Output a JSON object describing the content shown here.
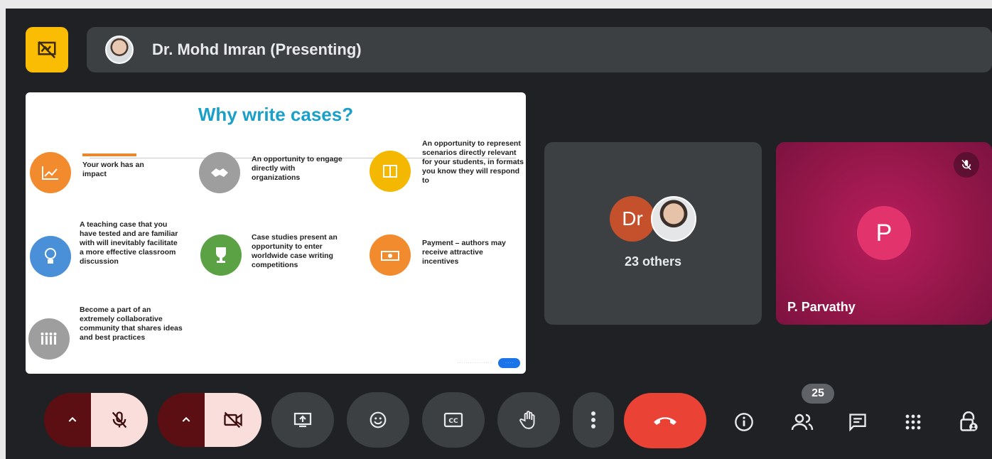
{
  "presenter": {
    "name": "Dr. Mohd Imran (Presenting)"
  },
  "slide": {
    "title": "Why write cases?",
    "items": [
      {
        "text": "Your work has an impact",
        "icon": "chart-icon",
        "color": "#f28b2e"
      },
      {
        "text": "An opportunity to engage directly with organizations",
        "icon": "handshake-icon",
        "color": "#9e9e9e"
      },
      {
        "text": "An opportunity to represent scenarios directly relevant for your students, in formats you know they will respond to",
        "icon": "book-icon",
        "color": "#f5b800"
      },
      {
        "text": "A teaching case that you have tested and are familiar with will inevitably facilitate a more effective classroom discussion",
        "icon": "lightbulb-icon",
        "color": "#4a90d9"
      },
      {
        "text": "Case studies present an opportunity to enter worldwide case writing competitions",
        "icon": "trophy-icon",
        "color": "#5ba245"
      },
      {
        "text": "Payment – authors may receive attractive incentives",
        "icon": "money-icon",
        "color": "#f28b2e"
      },
      {
        "text": "Become a part of an extremely collaborative community that shares ideas and best practices",
        "icon": "community-icon",
        "color": "#9e9e9e"
      }
    ]
  },
  "tiles": {
    "others": {
      "avatar_initials": "Dr",
      "label": "23 others"
    },
    "parvathy": {
      "avatar_initial": "P",
      "name": "P. Parvathy"
    }
  },
  "controls": {
    "participants_count": "25"
  },
  "colors": {
    "background": "#202124",
    "surface": "#3c4043",
    "end_call": "#ea4335",
    "present_accent": "#fbbc04"
  }
}
